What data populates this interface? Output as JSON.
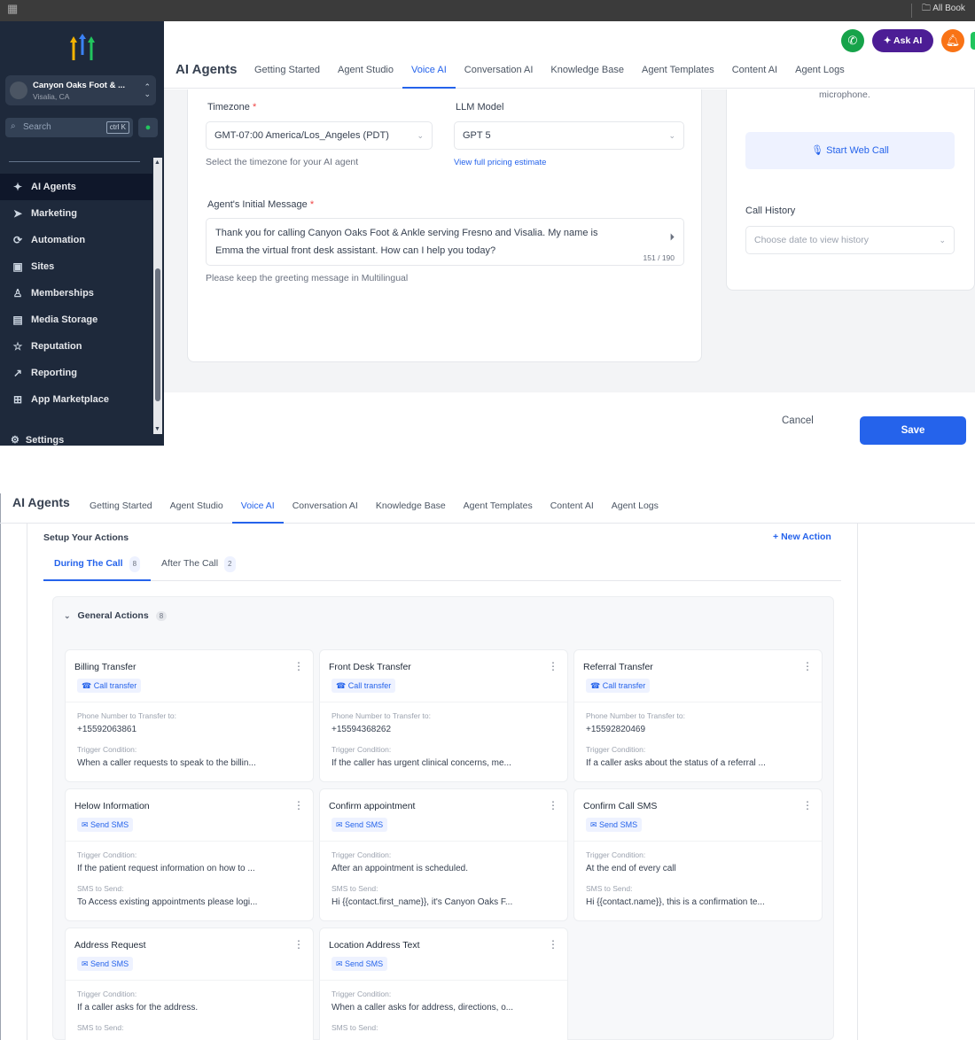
{
  "top_bar": {
    "bookmark_label": "All Book"
  },
  "sidebar": {
    "account_name": "Canyon Oaks Foot & ...",
    "account_location": "Visalia, CA",
    "search_placeholder": "Search",
    "search_shortcut": "ctrl K",
    "nav": [
      {
        "label": "AI Agents",
        "icon": "sparkle-icon",
        "active": true
      },
      {
        "label": "Marketing",
        "icon": "send-icon"
      },
      {
        "label": "Automation",
        "icon": "automation-icon"
      },
      {
        "label": "Sites",
        "icon": "sites-icon"
      },
      {
        "label": "Memberships",
        "icon": "memberships-icon"
      },
      {
        "label": "Media Storage",
        "icon": "media-icon"
      },
      {
        "label": "Reputation",
        "icon": "star-icon"
      },
      {
        "label": "Reporting",
        "icon": "chart-icon"
      },
      {
        "label": "App Marketplace",
        "icon": "grid-icon"
      }
    ],
    "settings_label": "Settings"
  },
  "header": {
    "title": "AI Agents",
    "ask_ai_label": "Ask AI",
    "tabs": [
      "Getting Started",
      "Agent Studio",
      "Voice AI",
      "Conversation AI",
      "Knowledge Base",
      "Agent Templates",
      "Content AI",
      "Agent Logs"
    ],
    "active_tab": "Voice AI"
  },
  "form": {
    "timezone_label": "Timezone",
    "timezone_value": "GMT-07:00 America/Los_Angeles (PDT)",
    "timezone_help": "Select the timezone for your AI agent",
    "llm_label": "LLM Model",
    "llm_value": "GPT 5",
    "pricing_link": "View full pricing estimate",
    "initial_message_label": "Agent's Initial Message",
    "initial_message_line1": "Thank you for calling Canyon Oaks Foot & Ankle serving Fresno and Visalia. My name is",
    "initial_message_line2": "Emma the virtual front desk assistant. How can I help you today?",
    "char_count": "151 / 190",
    "message_help": "Please keep the greeting message in Multilingual",
    "required_mark": "*"
  },
  "side_panel": {
    "mic_note": "microphone.",
    "start_web_call_label": "Start Web Call",
    "call_history_label": "Call History",
    "call_history_placeholder": "Choose date to view history"
  },
  "footer": {
    "cancel_label": "Cancel",
    "save_label": "Save"
  },
  "actions": {
    "setup_title": "Setup Your Actions",
    "new_action_label": "New Action",
    "subtabs": [
      {
        "label": "During The Call",
        "count": "8"
      },
      {
        "label": "After The Call",
        "count": "2"
      }
    ],
    "group_title": "General Actions",
    "group_count": "8",
    "cards": [
      {
        "title": "Billing Transfer",
        "type": "Call transfer",
        "f1_label": "Phone Number to Transfer to:",
        "f1_value": "+15592063861",
        "f2_label": "Trigger Condition:",
        "f2_value": "When a caller requests to speak to the billin..."
      },
      {
        "title": "Front Desk Transfer",
        "type": "Call transfer",
        "f1_label": "Phone Number to Transfer to:",
        "f1_value": "+15594368262",
        "f2_label": "Trigger Condition:",
        "f2_value": "If the caller has urgent clinical concerns, me..."
      },
      {
        "title": "Referral Transfer",
        "type": "Call transfer",
        "f1_label": "Phone Number to Transfer to:",
        "f1_value": "+15592820469",
        "f2_label": "Trigger Condition:",
        "f2_value": "If a caller asks about the status of a referral ..."
      },
      {
        "title": "Helow Information",
        "type": "Send SMS",
        "f1_label": "Trigger Condition:",
        "f1_value": "If the patient request information on how to ...",
        "f2_label": "SMS to Send:",
        "f2_value": "To Access existing appointments please logi..."
      },
      {
        "title": "Confirm appointment",
        "type": "Send SMS",
        "f1_label": "Trigger Condition:",
        "f1_value": "After an appointment is scheduled.",
        "f2_label": "SMS to Send:",
        "f2_value": "Hi {{contact.first_name}}, it's Canyon Oaks F..."
      },
      {
        "title": "Confirm Call SMS",
        "type": "Send SMS",
        "f1_label": "Trigger Condition:",
        "f1_value": "At the end of every call",
        "f2_label": "SMS to Send:",
        "f2_value": "Hi {{contact.name}}, this is a confirmation te..."
      },
      {
        "title": "Address Request",
        "type": "Send SMS",
        "f1_label": "Trigger Condition:",
        "f1_value": "If a caller asks for the address.",
        "f2_label": "SMS to Send:",
        "f2_value": ""
      },
      {
        "title": "Location Address Text",
        "type": "Send SMS",
        "f1_label": "Trigger Condition:",
        "f1_value": "When a caller asks for address, directions, o...",
        "f2_label": "SMS to Send:",
        "f2_value": ""
      }
    ]
  },
  "colors": {
    "accent": "#2563eb",
    "sidebar": "#1e293b",
    "ask_ai": "#4c1d95",
    "phone": "#16a34a",
    "notify": "#f97316"
  }
}
